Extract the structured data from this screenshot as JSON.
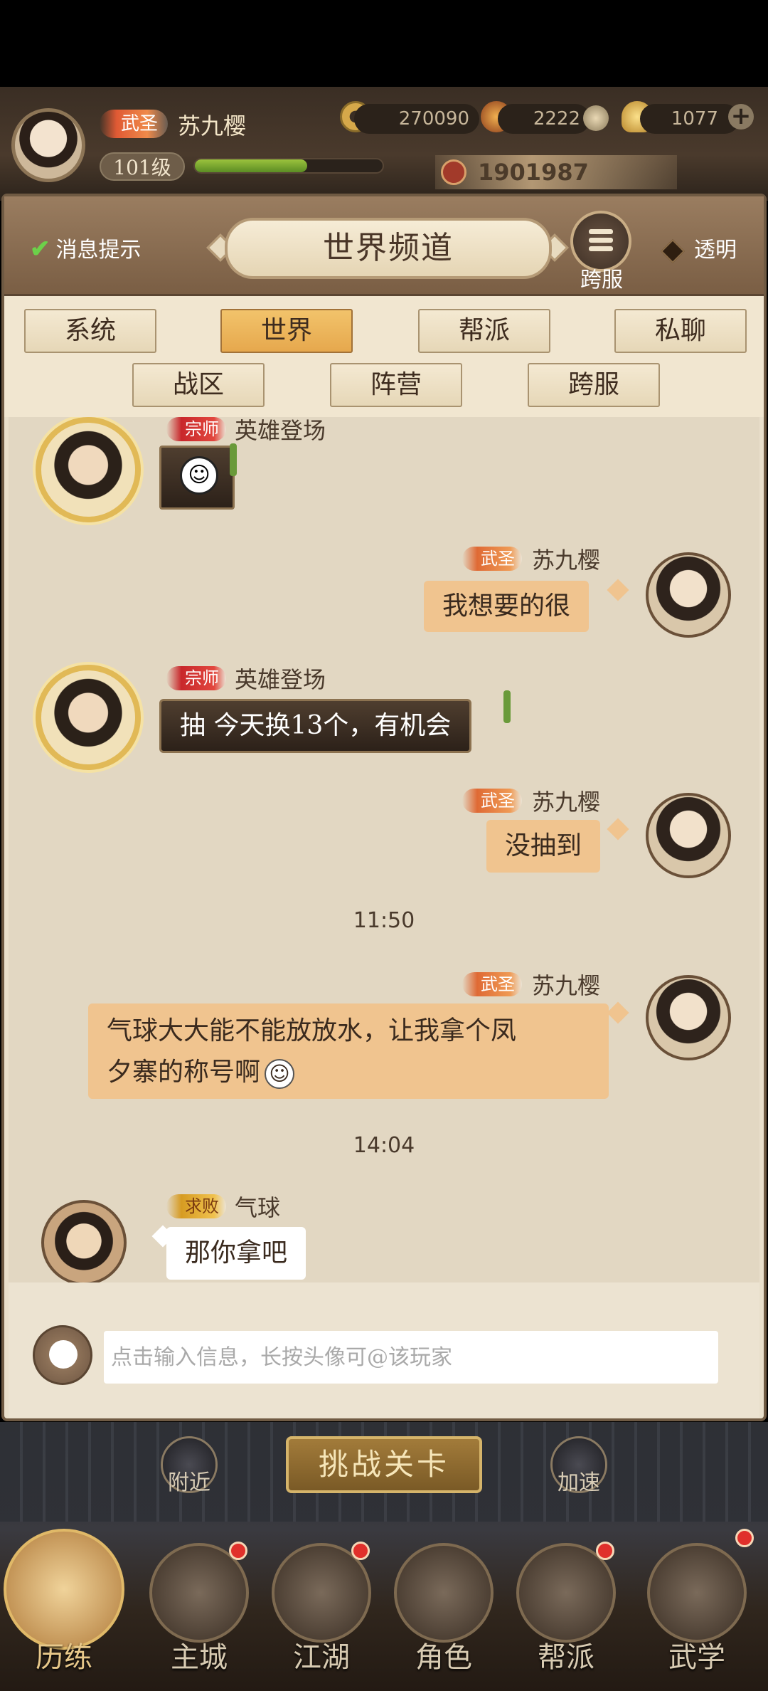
{
  "player": {
    "rank": "武圣",
    "name": "苏九樱",
    "level": "101级",
    "exp_fraction": 0.6,
    "copper": "270090",
    "gems": "2222",
    "gold": "1077",
    "power": "1901987"
  },
  "panel": {
    "notify_label": "消息提示",
    "title": "世界频道",
    "cross_server": "跨服",
    "transparent_label": "透明"
  },
  "tabs": [
    "系统",
    "世界",
    "帮派",
    "私聊",
    "战区",
    "阵营",
    "跨服"
  ],
  "active_tab": "世界",
  "messages": [
    {
      "rank": "宗师",
      "name": "英雄登场",
      "side": "left",
      "text": ""
    },
    {
      "rank": "武圣",
      "name": "苏九樱",
      "side": "right",
      "text": "我想要的很"
    },
    {
      "rank": "宗师",
      "name": "英雄登场",
      "side": "left",
      "text": "抽 今天换13个，有机会"
    },
    {
      "rank": "武圣",
      "name": "苏九樱",
      "side": "right",
      "text": "没抽到"
    },
    {
      "rank": "武圣",
      "name": "苏九樱",
      "side": "right",
      "text_line1": "气球大大能不能放放水，让我拿个凤",
      "text_line2": "夕寨的称号啊"
    },
    {
      "rank": "求败",
      "name": "气球",
      "side": "left",
      "text": "那你拿吧"
    }
  ],
  "timestamps": [
    "11:50",
    "14:04"
  ],
  "input": {
    "placeholder": "点击输入信息，长按头像可@该玩家"
  },
  "scene": {
    "nearby": "附近",
    "challenge": "挑战关卡",
    "speed": "加速"
  },
  "nav": [
    "历练",
    "主城",
    "江湖",
    "角色",
    "帮派",
    "武学"
  ],
  "colors": {
    "bubble_mine": "#f0c48f",
    "active_tab": "#e6a84d",
    "badge_red": "#e0302b"
  }
}
